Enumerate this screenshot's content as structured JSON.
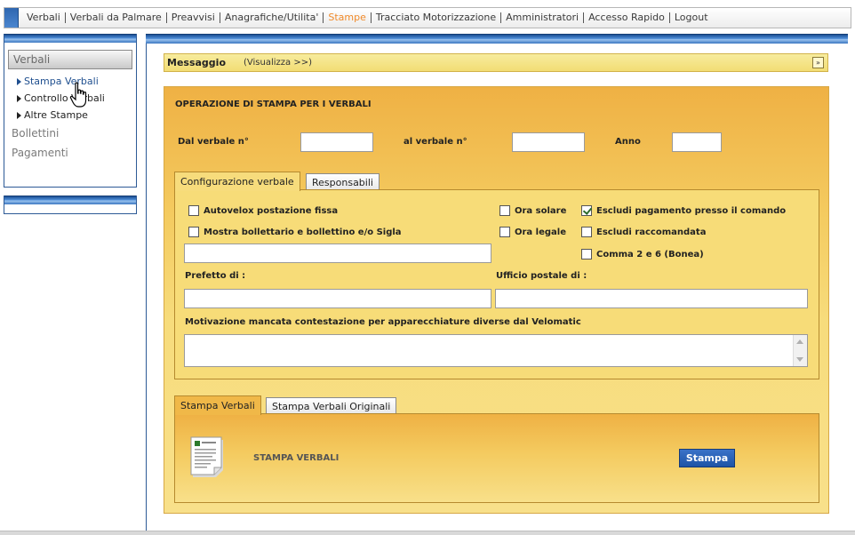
{
  "nav": {
    "items": [
      {
        "label": "Verbali",
        "active": false
      },
      {
        "label": "Verbali da Palmare",
        "active": false
      },
      {
        "label": "Preavvisi",
        "active": false
      },
      {
        "label": "Anagrafiche/Utilita'",
        "active": false
      },
      {
        "label": "Stampe",
        "active": true
      },
      {
        "label": "Tracciato Motorizzazione",
        "active": false
      },
      {
        "label": "Amministratori",
        "active": false
      },
      {
        "label": "Accesso Rapido",
        "active": false
      },
      {
        "label": "Logout",
        "active": false
      }
    ]
  },
  "sidebar": {
    "header": "Verbali",
    "subitems": [
      "Stampa Verbali",
      "Controllo Verbali",
      "Altre Stampe"
    ],
    "sections": [
      "Bollettini",
      "Pagamenti"
    ]
  },
  "message": {
    "title": "Messaggio",
    "link": "(Visualizza >>)",
    "toggle": "»"
  },
  "form": {
    "title": "OPERAZIONE DI STAMPA PER I VERBALI",
    "dal_label": "Dal verbale n°",
    "al_label": "al verbale n°",
    "anno_label": "Anno",
    "dal_value": "",
    "al_value": "",
    "anno_value": ""
  },
  "tabs_top": {
    "config": "Configurazione verbale",
    "resp": "Responsabili"
  },
  "config": {
    "autovelox": {
      "label": "Autovelox postazione fissa",
      "checked": false
    },
    "mostra": {
      "label": "Mostra bollettario e bollettino e/o Sigla",
      "checked": false
    },
    "ora_solare": {
      "label": "Ora solare",
      "checked": false
    },
    "ora_legale": {
      "label": "Ora legale",
      "checked": false
    },
    "escludi_pag": {
      "label": "Escludi pagamento presso il comando",
      "checked": true
    },
    "escludi_racc": {
      "label": "Escludi raccomandata",
      "checked": false
    },
    "comma": {
      "label": "Comma 2 e 6 (Bonea)",
      "checked": false
    },
    "sigla_value": "",
    "prefetto_label": "Prefetto di :",
    "prefetto_value": "",
    "ufficio_label": "Ufficio postale di :",
    "ufficio_value": "",
    "motivazione_label": "Motivazione mancata contestazione per apparecchiature diverse dal Velomatic",
    "motivazione_value": ""
  },
  "tabs_bottom": {
    "stampa": "Stampa Verbali",
    "originali": "Stampa Verbali Originali"
  },
  "stampa": {
    "label": "STAMPA VERBALI",
    "button": "Stampa"
  }
}
